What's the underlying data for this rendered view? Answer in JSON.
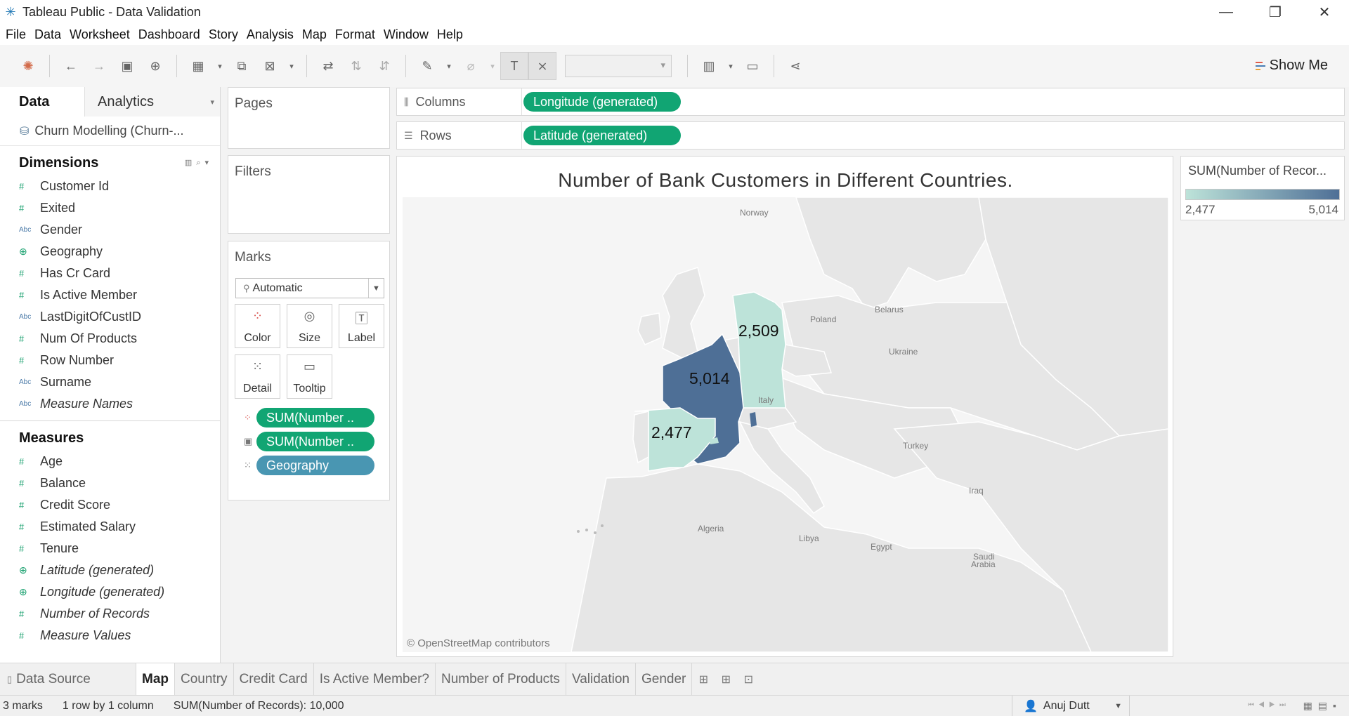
{
  "window": {
    "title": "Tableau Public - Data Validation"
  },
  "menu": [
    "File",
    "Data",
    "Worksheet",
    "Dashboard",
    "Story",
    "Analysis",
    "Map",
    "Format",
    "Window",
    "Help"
  ],
  "toolbar": {
    "show_me_label": "Show Me"
  },
  "data_pane": {
    "tab_data": "Data",
    "tab_analytics": "Analytics",
    "datasource": "Churn Modelling (Churn-...",
    "dimensions_header": "Dimensions",
    "dimensions": [
      {
        "label": "Customer Id",
        "type": "number",
        "italic": false
      },
      {
        "label": "Exited",
        "type": "number",
        "italic": false
      },
      {
        "label": "Gender",
        "type": "string",
        "italic": false
      },
      {
        "label": "Geography",
        "type": "geo",
        "italic": false
      },
      {
        "label": "Has Cr Card",
        "type": "number",
        "italic": false
      },
      {
        "label": "Is Active Member",
        "type": "number",
        "italic": false
      },
      {
        "label": "LastDigitOfCustID",
        "type": "string",
        "italic": false
      },
      {
        "label": "Num Of Products",
        "type": "number",
        "italic": false
      },
      {
        "label": "Row Number",
        "type": "number",
        "italic": false
      },
      {
        "label": "Surname",
        "type": "string",
        "italic": false
      },
      {
        "label": "Measure Names",
        "type": "string",
        "italic": true
      }
    ],
    "measures_header": "Measures",
    "measures": [
      {
        "label": "Age",
        "type": "number",
        "italic": false
      },
      {
        "label": "Balance",
        "type": "number",
        "italic": false
      },
      {
        "label": "Credit Score",
        "type": "number",
        "italic": false
      },
      {
        "label": "Estimated Salary",
        "type": "number",
        "italic": false
      },
      {
        "label": "Tenure",
        "type": "number",
        "italic": false
      },
      {
        "label": "Latitude (generated)",
        "type": "geo",
        "italic": true
      },
      {
        "label": "Longitude (generated)",
        "type": "geo",
        "italic": true
      },
      {
        "label": "Number of Records",
        "type": "number",
        "italic": true
      },
      {
        "label": "Measure Values",
        "type": "number",
        "italic": true
      }
    ]
  },
  "cards": {
    "pages": "Pages",
    "filters": "Filters",
    "marks": "Marks",
    "mark_type": "Automatic",
    "buttons": {
      "color": "Color",
      "size": "Size",
      "label": "Label",
      "detail": "Detail",
      "tooltip": "Tooltip"
    },
    "mark_pills": [
      "SUM(Number ..",
      "SUM(Number ..",
      "Geography"
    ]
  },
  "shelves": {
    "columns_label": "Columns",
    "columns_pill": "Longitude (generated)",
    "rows_label": "Rows",
    "rows_pill": "Latitude (generated)"
  },
  "viz": {
    "title": "Number of Bank Customers in Different Countries.",
    "attribution": "© OpenStreetMap contributors",
    "places": [
      "Norway",
      "Poland",
      "Belarus",
      "Ukraine",
      "Italy",
      "Turkey",
      "Iraq",
      "Algeria",
      "Libya",
      "Egypt",
      "Saudi",
      "Arabia"
    ],
    "country_values": {
      "France": "5,014",
      "Germany": "2,509",
      "Spain": "2,477"
    },
    "colors": {
      "high": "#4e6f96",
      "low": "#bde3d9",
      "land": "#e6e6e6",
      "water": "#f4f4f4"
    }
  },
  "legend": {
    "title": "SUM(Number of Recor...",
    "min": "2,477",
    "max": "5,014"
  },
  "sheets": {
    "data_source": "Data Source",
    "tabs": [
      "Map",
      "Country",
      "Credit Card",
      "Is Active Member?",
      "Number of Products",
      "Validation",
      "Gender"
    ],
    "active": "Map"
  },
  "status": {
    "marks": "3 marks",
    "dims": "1 row by 1 column",
    "sum": "SUM(Number of Records): 10,000",
    "user": "Anuj Dutt"
  }
}
